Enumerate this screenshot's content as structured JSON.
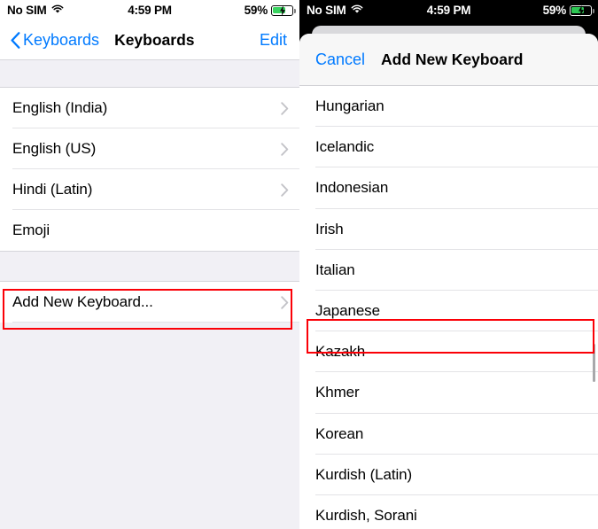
{
  "status_bar": {
    "carrier": "No SIM",
    "wifi_icon": "wifi-icon",
    "time": "4:59 PM",
    "battery_percent": "59%",
    "battery_icon": "battery-charging-icon",
    "battery_level": 59
  },
  "colors": {
    "accent_blue": "#007aff",
    "highlight_red": "#fb0007",
    "battery_green": "#30d158",
    "group_background": "#f1f0f5",
    "separator": "#e3e3e6"
  },
  "left_screen": {
    "nav": {
      "back_label": "Keyboards",
      "back_icon": "chevron-left-icon",
      "title": "Keyboards",
      "edit_label": "Edit"
    },
    "keyboards": [
      {
        "label": "English (India)",
        "chevron": true
      },
      {
        "label": "English (US)",
        "chevron": true
      },
      {
        "label": "Hindi (Latin)",
        "chevron": true
      },
      {
        "label": "Emoji",
        "chevron": false
      }
    ],
    "add_new": {
      "label": "Add New Keyboard...",
      "chevron": true,
      "highlighted": true
    }
  },
  "right_screen": {
    "sheet": {
      "cancel_label": "Cancel",
      "title": "Add New Keyboard"
    },
    "languages": [
      {
        "label": "Hungarian",
        "highlighted": false
      },
      {
        "label": "Icelandic",
        "highlighted": false
      },
      {
        "label": "Indonesian",
        "highlighted": false
      },
      {
        "label": "Irish",
        "highlighted": false
      },
      {
        "label": "Italian",
        "highlighted": false
      },
      {
        "label": "Japanese",
        "highlighted": true
      },
      {
        "label": "Kazakh",
        "highlighted": false
      },
      {
        "label": "Khmer",
        "highlighted": false
      },
      {
        "label": "Korean",
        "highlighted": false
      },
      {
        "label": "Kurdish (Latin)",
        "highlighted": false
      },
      {
        "label": "Kurdish, Sorani",
        "highlighted": false
      }
    ],
    "scroll_indicator": "vertical-scrollbar"
  }
}
